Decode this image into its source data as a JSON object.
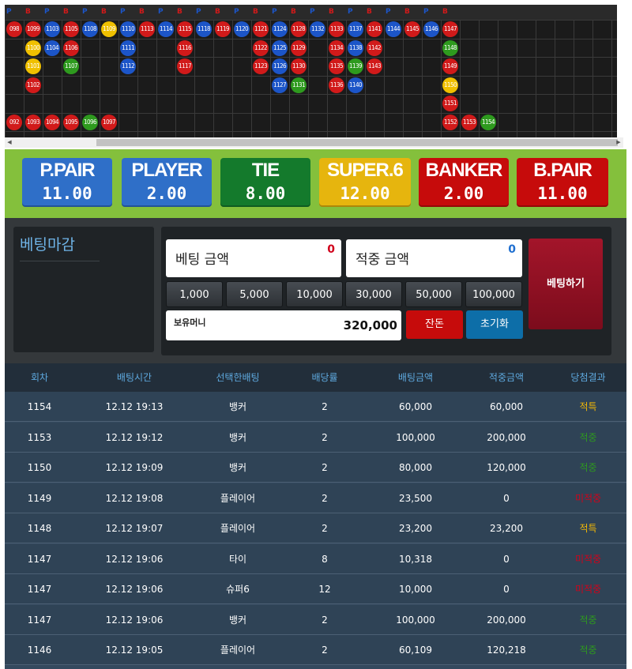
{
  "road": {
    "header": [
      "P",
      "B",
      "P",
      "B",
      "P",
      "B",
      "P",
      "B",
      "P",
      "B",
      "P",
      "B",
      "P",
      "B",
      "P",
      "B",
      "P",
      "B",
      "P",
      "B",
      "P",
      "B",
      "P",
      "B"
    ],
    "header_colors": {
      "P": "#1c55c8",
      "B": "#d11a1a"
    },
    "beads": [
      {
        "label": "098",
        "c": 0,
        "r": 0,
        "color": "r"
      },
      {
        "label": "1099",
        "c": 1,
        "r": 0,
        "color": "r"
      },
      {
        "label": "1103",
        "c": 2,
        "r": 0,
        "color": "b"
      },
      {
        "label": "1105",
        "c": 3,
        "r": 0,
        "color": "r"
      },
      {
        "label": "1108",
        "c": 4,
        "r": 0,
        "color": "b"
      },
      {
        "label": "1109",
        "c": 5,
        "r": 0,
        "color": "y"
      },
      {
        "label": "1110",
        "c": 6,
        "r": 0,
        "color": "b"
      },
      {
        "label": "1113",
        "c": 7,
        "r": 0,
        "color": "r"
      },
      {
        "label": "1114",
        "c": 8,
        "r": 0,
        "color": "b"
      },
      {
        "label": "1115",
        "c": 9,
        "r": 0,
        "color": "r"
      },
      {
        "label": "1118",
        "c": 10,
        "r": 0,
        "color": "b"
      },
      {
        "label": "1119",
        "c": 11,
        "r": 0,
        "color": "r"
      },
      {
        "label": "1120",
        "c": 12,
        "r": 0,
        "color": "b"
      },
      {
        "label": "1121",
        "c": 13,
        "r": 0,
        "color": "r"
      },
      {
        "label": "1124",
        "c": 14,
        "r": 0,
        "color": "b"
      },
      {
        "label": "1128",
        "c": 15,
        "r": 0,
        "color": "r"
      },
      {
        "label": "1132",
        "c": 16,
        "r": 0,
        "color": "b"
      },
      {
        "label": "1133",
        "c": 17,
        "r": 0,
        "color": "r"
      },
      {
        "label": "1137",
        "c": 18,
        "r": 0,
        "color": "b"
      },
      {
        "label": "1141",
        "c": 19,
        "r": 0,
        "color": "r"
      },
      {
        "label": "1144",
        "c": 20,
        "r": 0,
        "color": "b"
      },
      {
        "label": "1145",
        "c": 21,
        "r": 0,
        "color": "r"
      },
      {
        "label": "1146",
        "c": 22,
        "r": 0,
        "color": "b"
      },
      {
        "label": "1147",
        "c": 23,
        "r": 0,
        "color": "r"
      },
      {
        "label": "1100",
        "c": 1,
        "r": 1,
        "color": "y"
      },
      {
        "label": "1104",
        "c": 2,
        "r": 1,
        "color": "b"
      },
      {
        "label": "1106",
        "c": 3,
        "r": 1,
        "color": "r"
      },
      {
        "label": "1111",
        "c": 6,
        "r": 1,
        "color": "b"
      },
      {
        "label": "1116",
        "c": 9,
        "r": 1,
        "color": "r"
      },
      {
        "label": "1122",
        "c": 13,
        "r": 1,
        "color": "r"
      },
      {
        "label": "1125",
        "c": 14,
        "r": 1,
        "color": "b"
      },
      {
        "label": "1129",
        "c": 15,
        "r": 1,
        "color": "r"
      },
      {
        "label": "1134",
        "c": 17,
        "r": 1,
        "color": "r"
      },
      {
        "label": "1138",
        "c": 18,
        "r": 1,
        "color": "b"
      },
      {
        "label": "1142",
        "c": 19,
        "r": 1,
        "color": "r"
      },
      {
        "label": "1148",
        "c": 23,
        "r": 1,
        "color": "g"
      },
      {
        "label": "1101",
        "c": 1,
        "r": 2,
        "color": "y"
      },
      {
        "label": "1107",
        "c": 3,
        "r": 2,
        "color": "g"
      },
      {
        "label": "1112",
        "c": 6,
        "r": 2,
        "color": "b"
      },
      {
        "label": "1117",
        "c": 9,
        "r": 2,
        "color": "r"
      },
      {
        "label": "1123",
        "c": 13,
        "r": 2,
        "color": "r"
      },
      {
        "label": "1126",
        "c": 14,
        "r": 2,
        "color": "b"
      },
      {
        "label": "1130",
        "c": 15,
        "r": 2,
        "color": "r"
      },
      {
        "label": "1135",
        "c": 17,
        "r": 2,
        "color": "r"
      },
      {
        "label": "1139",
        "c": 18,
        "r": 2,
        "color": "g"
      },
      {
        "label": "1143",
        "c": 19,
        "r": 2,
        "color": "r"
      },
      {
        "label": "1149",
        "c": 23,
        "r": 2,
        "color": "r"
      },
      {
        "label": "1102",
        "c": 1,
        "r": 3,
        "color": "r"
      },
      {
        "label": "1127",
        "c": 14,
        "r": 3,
        "color": "b"
      },
      {
        "label": "1131",
        "c": 15,
        "r": 3,
        "color": "g"
      },
      {
        "label": "1136",
        "c": 17,
        "r": 3,
        "color": "r"
      },
      {
        "label": "1140",
        "c": 18,
        "r": 3,
        "color": "b"
      },
      {
        "label": "1150",
        "c": 23,
        "r": 3,
        "color": "y"
      },
      {
        "label": "1151",
        "c": 23,
        "r": 4,
        "color": "r"
      },
      {
        "label": "092",
        "c": 0,
        "r": 5,
        "color": "r"
      },
      {
        "label": "1093",
        "c": 1,
        "r": 5,
        "color": "r"
      },
      {
        "label": "1094",
        "c": 2,
        "r": 5,
        "color": "r"
      },
      {
        "label": "1095",
        "c": 3,
        "r": 5,
        "color": "r"
      },
      {
        "label": "1096",
        "c": 4,
        "r": 5,
        "color": "g"
      },
      {
        "label": "1097",
        "c": 5,
        "r": 5,
        "color": "r"
      },
      {
        "label": "1152",
        "c": 23,
        "r": 5,
        "color": "r"
      },
      {
        "label": "1153",
        "c": 24,
        "r": 5,
        "color": "r"
      },
      {
        "label": "1154",
        "c": 25,
        "r": 5,
        "color": "g"
      }
    ]
  },
  "bets": [
    {
      "name": "P.PAIR",
      "odds": "11.00",
      "color": "#2f6fc8"
    },
    {
      "name": "PLAYER",
      "odds": "2.00",
      "color": "#2f6fc8"
    },
    {
      "name": "TIE",
      "odds": "8.00",
      "color": "#147a2c"
    },
    {
      "name": "SUPER.6",
      "odds": "12.00",
      "color": "#e6b50e"
    },
    {
      "name": "BANKER",
      "odds": "2.00",
      "color": "#c60b0b"
    },
    {
      "name": "B.PAIR",
      "odds": "11.00",
      "color": "#c60b0b"
    }
  ],
  "status": {
    "closed_label": "베팅마감"
  },
  "bet_form": {
    "bet_amount_label": "베팅 금액",
    "bet_amount_value": "0",
    "win_amount_label": "적중 금액",
    "win_amount_value": "0",
    "chips": [
      "1,000",
      "5,000",
      "10,000",
      "30,000",
      "50,000",
      "100,000"
    ],
    "balance_label": "보유머니",
    "balance_value": "320,000",
    "change_button": "잔돈",
    "reset_button": "초기화",
    "place_bet_button": "베팅하기"
  },
  "history": {
    "columns": [
      "회차",
      "배팅시간",
      "선택한배팅",
      "배당률",
      "배팅금액",
      "적중금액",
      "당첨결과"
    ],
    "rows": [
      {
        "round": "1154",
        "time": "12.12 19:13",
        "pick": "뱅커",
        "odds": "2",
        "bet": "60,000",
        "win": "60,000",
        "result": "적특",
        "result_type": "win"
      },
      {
        "round": "1153",
        "time": "12.12 19:12",
        "pick": "뱅커",
        "odds": "2",
        "bet": "100,000",
        "win": "200,000",
        "result": "적중",
        "result_type": "hit"
      },
      {
        "round": "1150",
        "time": "12.12 19:09",
        "pick": "뱅커",
        "odds": "2",
        "bet": "80,000",
        "win": "120,000",
        "result": "적중",
        "result_type": "hit"
      },
      {
        "round": "1149",
        "time": "12.12 19:08",
        "pick": "플레이어",
        "odds": "2",
        "bet": "23,500",
        "win": "0",
        "result": "미적중",
        "result_type": "miss"
      },
      {
        "round": "1148",
        "time": "12.12 19:07",
        "pick": "플레이어",
        "odds": "2",
        "bet": "23,200",
        "win": "23,200",
        "result": "적특",
        "result_type": "win"
      },
      {
        "round": "1147",
        "time": "12.12 19:06",
        "pick": "타이",
        "odds": "8",
        "bet": "10,318",
        "win": "0",
        "result": "미적중",
        "result_type": "miss"
      },
      {
        "round": "1147",
        "time": "12.12 19:06",
        "pick": "슈퍼6",
        "odds": "12",
        "bet": "10,000",
        "win": "0",
        "result": "미적중",
        "result_type": "miss"
      },
      {
        "round": "1147",
        "time": "12.12 19:06",
        "pick": "뱅커",
        "odds": "2",
        "bet": "100,000",
        "win": "200,000",
        "result": "적중",
        "result_type": "hit"
      },
      {
        "round": "1146",
        "time": "12.12 19:05",
        "pick": "플레이어",
        "odds": "2",
        "bet": "60,109",
        "win": "120,218",
        "result": "적중",
        "result_type": "hit"
      }
    ]
  }
}
